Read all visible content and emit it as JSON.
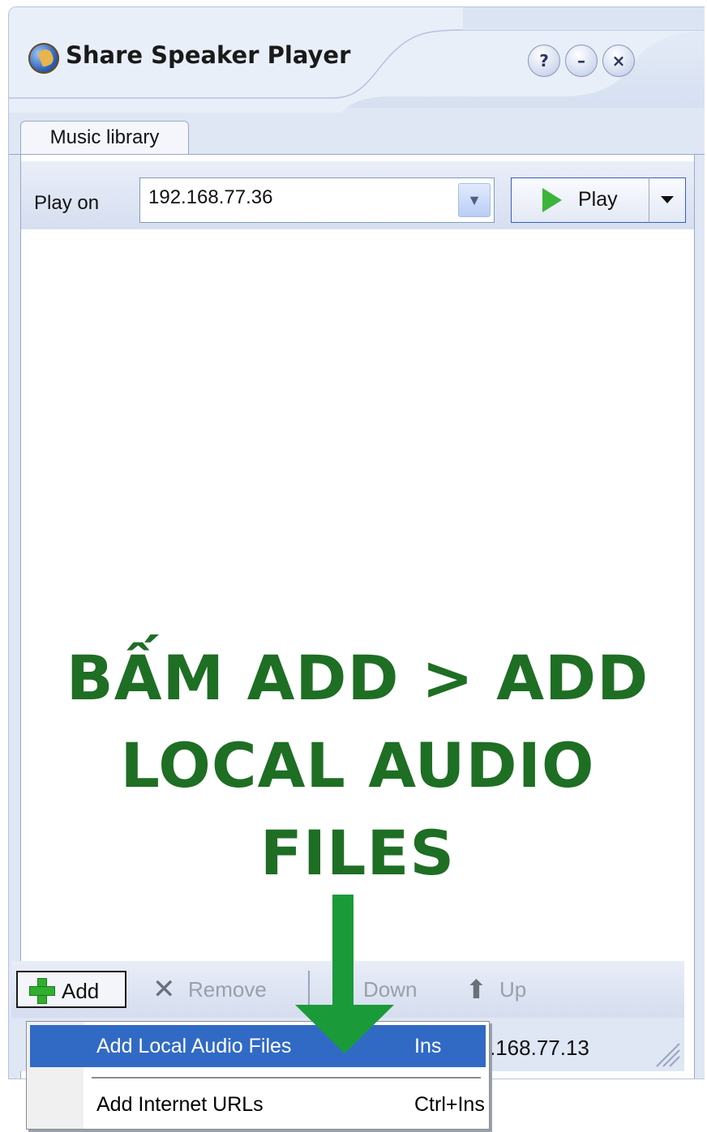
{
  "window": {
    "title": "Share Speaker Player",
    "help_button": "?",
    "minimize_button": "–",
    "close_button": "×"
  },
  "tabs": [
    {
      "label": "Music library",
      "active": true
    }
  ],
  "playbar": {
    "play_on_label": "Play on",
    "device_value": "192.168.77.36",
    "play_label": "Play"
  },
  "overlay": {
    "lines": [
      "BẤM ADD > ADD",
      "LOCAL AUDIO",
      "FILES"
    ],
    "color": "#1e6e24",
    "arrow_color": "#1b9a3a"
  },
  "toolbar": {
    "add_label": "Add",
    "remove_label": "Remove",
    "down_label": "Down",
    "up_label": "Up"
  },
  "statusbar": {
    "text": ".168.77.13"
  },
  "menu": {
    "items": [
      {
        "label": "Add Local Audio Files",
        "shortcut": "Ins",
        "highlighted": true
      },
      {
        "label": "Add Internet URLs",
        "shortcut": "Ctrl+Ins",
        "highlighted": false
      }
    ],
    "highlight_color": "#316ac5"
  }
}
